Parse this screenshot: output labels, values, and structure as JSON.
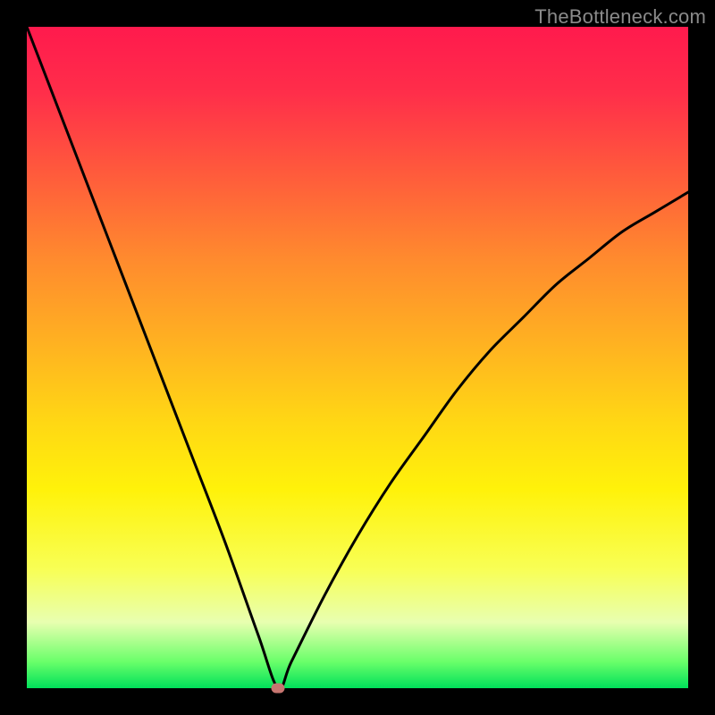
{
  "watermark": "TheBottleneck.com",
  "chart_data": {
    "type": "line",
    "title": "",
    "xlabel": "",
    "ylabel": "",
    "xlim": [
      0,
      100
    ],
    "ylim": [
      0,
      100
    ],
    "background_gradient": {
      "top_color": "#ff1a4d",
      "mid_color": "#ffe000",
      "bottom_color": "#00e05a"
    },
    "curve_description": "V-shaped bottleneck curve: falls sharply from upper-left to a minimum near x≈38, y≈0, then rises with diminishing slope toward upper-right",
    "x": [
      0,
      5,
      10,
      15,
      20,
      25,
      30,
      35,
      38,
      40,
      45,
      50,
      55,
      60,
      65,
      70,
      75,
      80,
      85,
      90,
      95,
      100
    ],
    "values": [
      100,
      87,
      74,
      61,
      48,
      35,
      22,
      8,
      0,
      4,
      14,
      23,
      31,
      38,
      45,
      51,
      56,
      61,
      65,
      69,
      72,
      75
    ],
    "marker": {
      "x": 38,
      "y": 0,
      "color": "#c77570"
    }
  }
}
